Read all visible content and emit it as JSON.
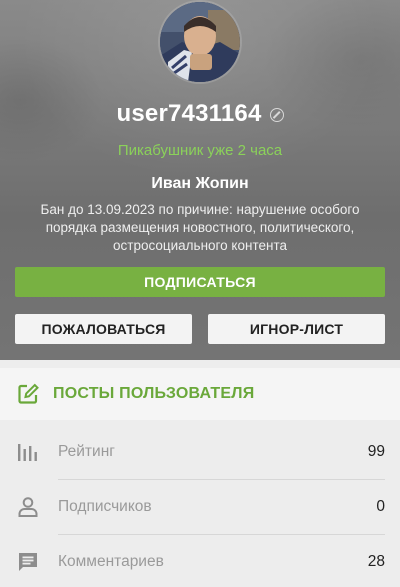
{
  "profile": {
    "username": "user7431164",
    "tenure": "Пикабушник уже 2 часа",
    "real_name": "Иван Жопин",
    "ban_reason": "Бан до 13.09.2023 по причине: нарушение особого порядка размещения новостного, политического, остросоциального контента",
    "status_icon": "ban-icon"
  },
  "actions": {
    "subscribe": "ПОДПИСАТЬСЯ",
    "report": "ПОЖАЛОВАТЬСЯ",
    "ignore": "ИГНОР-ЛИСТ"
  },
  "posts": {
    "label": "ПОСТЫ ПОЛЬЗОВАТЕЛЯ",
    "icon": "edit-icon"
  },
  "stats": [
    {
      "label": "Рейтинг",
      "value": "99",
      "icon": "bar-chart-icon"
    },
    {
      "label": "Подписчиков",
      "value": "0",
      "icon": "user-icon"
    },
    {
      "label": "Комментариев",
      "value": "28",
      "icon": "comment-icon"
    }
  ],
  "colors": {
    "accent_green": "#78b142",
    "tenure_green": "#8bd15a",
    "posts_green": "#6aa83a"
  }
}
